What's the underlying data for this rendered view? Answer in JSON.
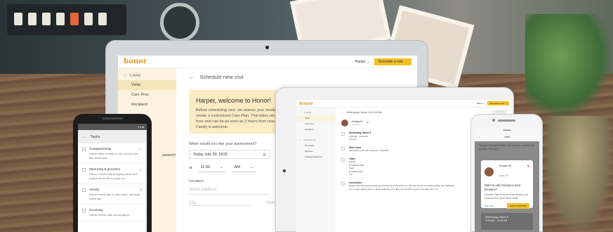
{
  "laptop": {
    "logo": "honor",
    "user": "Harper ⌄",
    "schedule_btn": "Schedule a visit →",
    "sidebar": {
      "section": "CARE",
      "items": [
        "Visits",
        "Care Pros",
        "Recipient"
      ],
      "cut_item": "assword"
    },
    "breadcrumb": "Schedule new visit",
    "welcome": {
      "title": "Harper, welcome to Honor!",
      "body": "Before scheduling care, we assess your needs and create a customized Care Plan. This takes about an hour and can be as soon as 2 hours from now. Family is welcome."
    },
    "form": {
      "question": "When would you like your assessment?",
      "date": "Today July 30, 2015",
      "at_label": "at",
      "time": "11:00",
      "ampm": "AM",
      "location_label": "Location",
      "street_placeholder": "Street Address",
      "city_placeholder": "City",
      "state_placeholder": "State"
    }
  },
  "tablet": {
    "logo": "honor",
    "user": "Harper ⌄",
    "schedule_btn": "Schedule a visit →",
    "sidebar": {
      "section1": "CARE",
      "items1": [
        "Visits",
        "Care Pros",
        "Recipient"
      ],
      "section2": "ACCOUNT",
      "items2": [
        "My Profile",
        "Payment",
        "Change Password"
      ]
    },
    "breadcrumb": "Wednesday, March 5 at 9:00 AM",
    "status": "Scheduled",
    "pro_name": "Viviana M.",
    "pro_role": "Care Pro",
    "rows": [
      {
        "title": "Wednesday, March 5",
        "sub": "9:00 AM – 11:00 AM",
        "sub2": "2 hours"
      },
      {
        "title": "Work home",
        "sub": "123 Alabama St. San Francisco, CA 94110"
      },
      {
        "title": "Tasks",
        "sub": "Activity",
        "sub2": "Companionship",
        "sub3": "Food",
        "sub4": "Housekeeping",
        "link": "Edit"
      },
      {
        "title": "Instructions",
        "sub": "Please help with grocery shopping and tidying up the kitchen so she can access something easily. She might ask you to help making pie for a family gathering on Friday, that would be good if you have time!",
        "link": "Edit"
      }
    ]
  },
  "android": {
    "header": "Tasks",
    "tasks": [
      {
        "title": "Companionship",
        "desc": "Harper likes to listen to old records and talk about jazz."
      },
      {
        "title": "Meal prep & groceries",
        "desc": "Harper needs help prepping lunch and maybe some dinner prep too."
      },
      {
        "title": "Activity",
        "desc": "Harper would like to stay active and walk every day."
      },
      {
        "title": "Grooming",
        "desc": "Harper needs help showering so"
      }
    ]
  },
  "iphone": {
    "nav_title": "Visit",
    "bg_text": "Margaret did great today! We went for a walk to the grocery. She didn't",
    "modal": {
      "name": "Viviana M.",
      "role": "Care Pro",
      "question": "Want to add Viviana to your favorites?",
      "body": "Favorite Care Pros are more likely to be scheduled for your future visits.",
      "no_btn": "Not now",
      "yes_btn": "Add to favorites"
    },
    "card_date": "Wednesday, March 5",
    "card_time": "9:00 AM – 11:00 AM"
  }
}
